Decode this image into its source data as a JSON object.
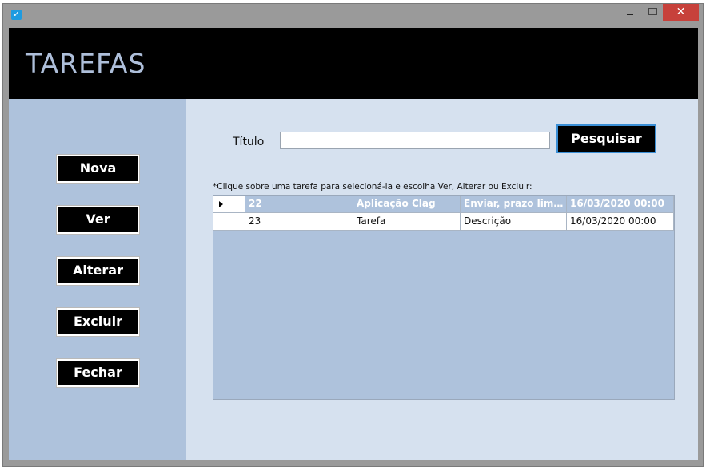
{
  "window": {
    "close_glyph": "✕"
  },
  "header": {
    "title": "TAREFAS"
  },
  "sidebar": {
    "buttons": [
      "Nova",
      "Ver",
      "Alterar",
      "Excluir",
      "Fechar"
    ]
  },
  "search": {
    "label": "Título",
    "value": "",
    "button_label": "Pesquisar"
  },
  "hint": "*Clique sobre uma tarefa para selecioná-la e escolha Ver, Alterar ou Excluir:",
  "grid": {
    "rows": [
      [
        "22",
        "Aplicação Clag",
        "Enviar, prazo limite",
        "16/03/2020 00:00"
      ],
      [
        "23",
        "Tarefa",
        "Descrição",
        "16/03/2020 00:00"
      ]
    ],
    "selected_row": 0
  },
  "colors": {
    "header_bg": "#000000",
    "sidebar_bg": "#aec2dc",
    "client_bg": "#d6e1ef",
    "title_color": "#aebfda",
    "close_bg": "#c7413b"
  }
}
